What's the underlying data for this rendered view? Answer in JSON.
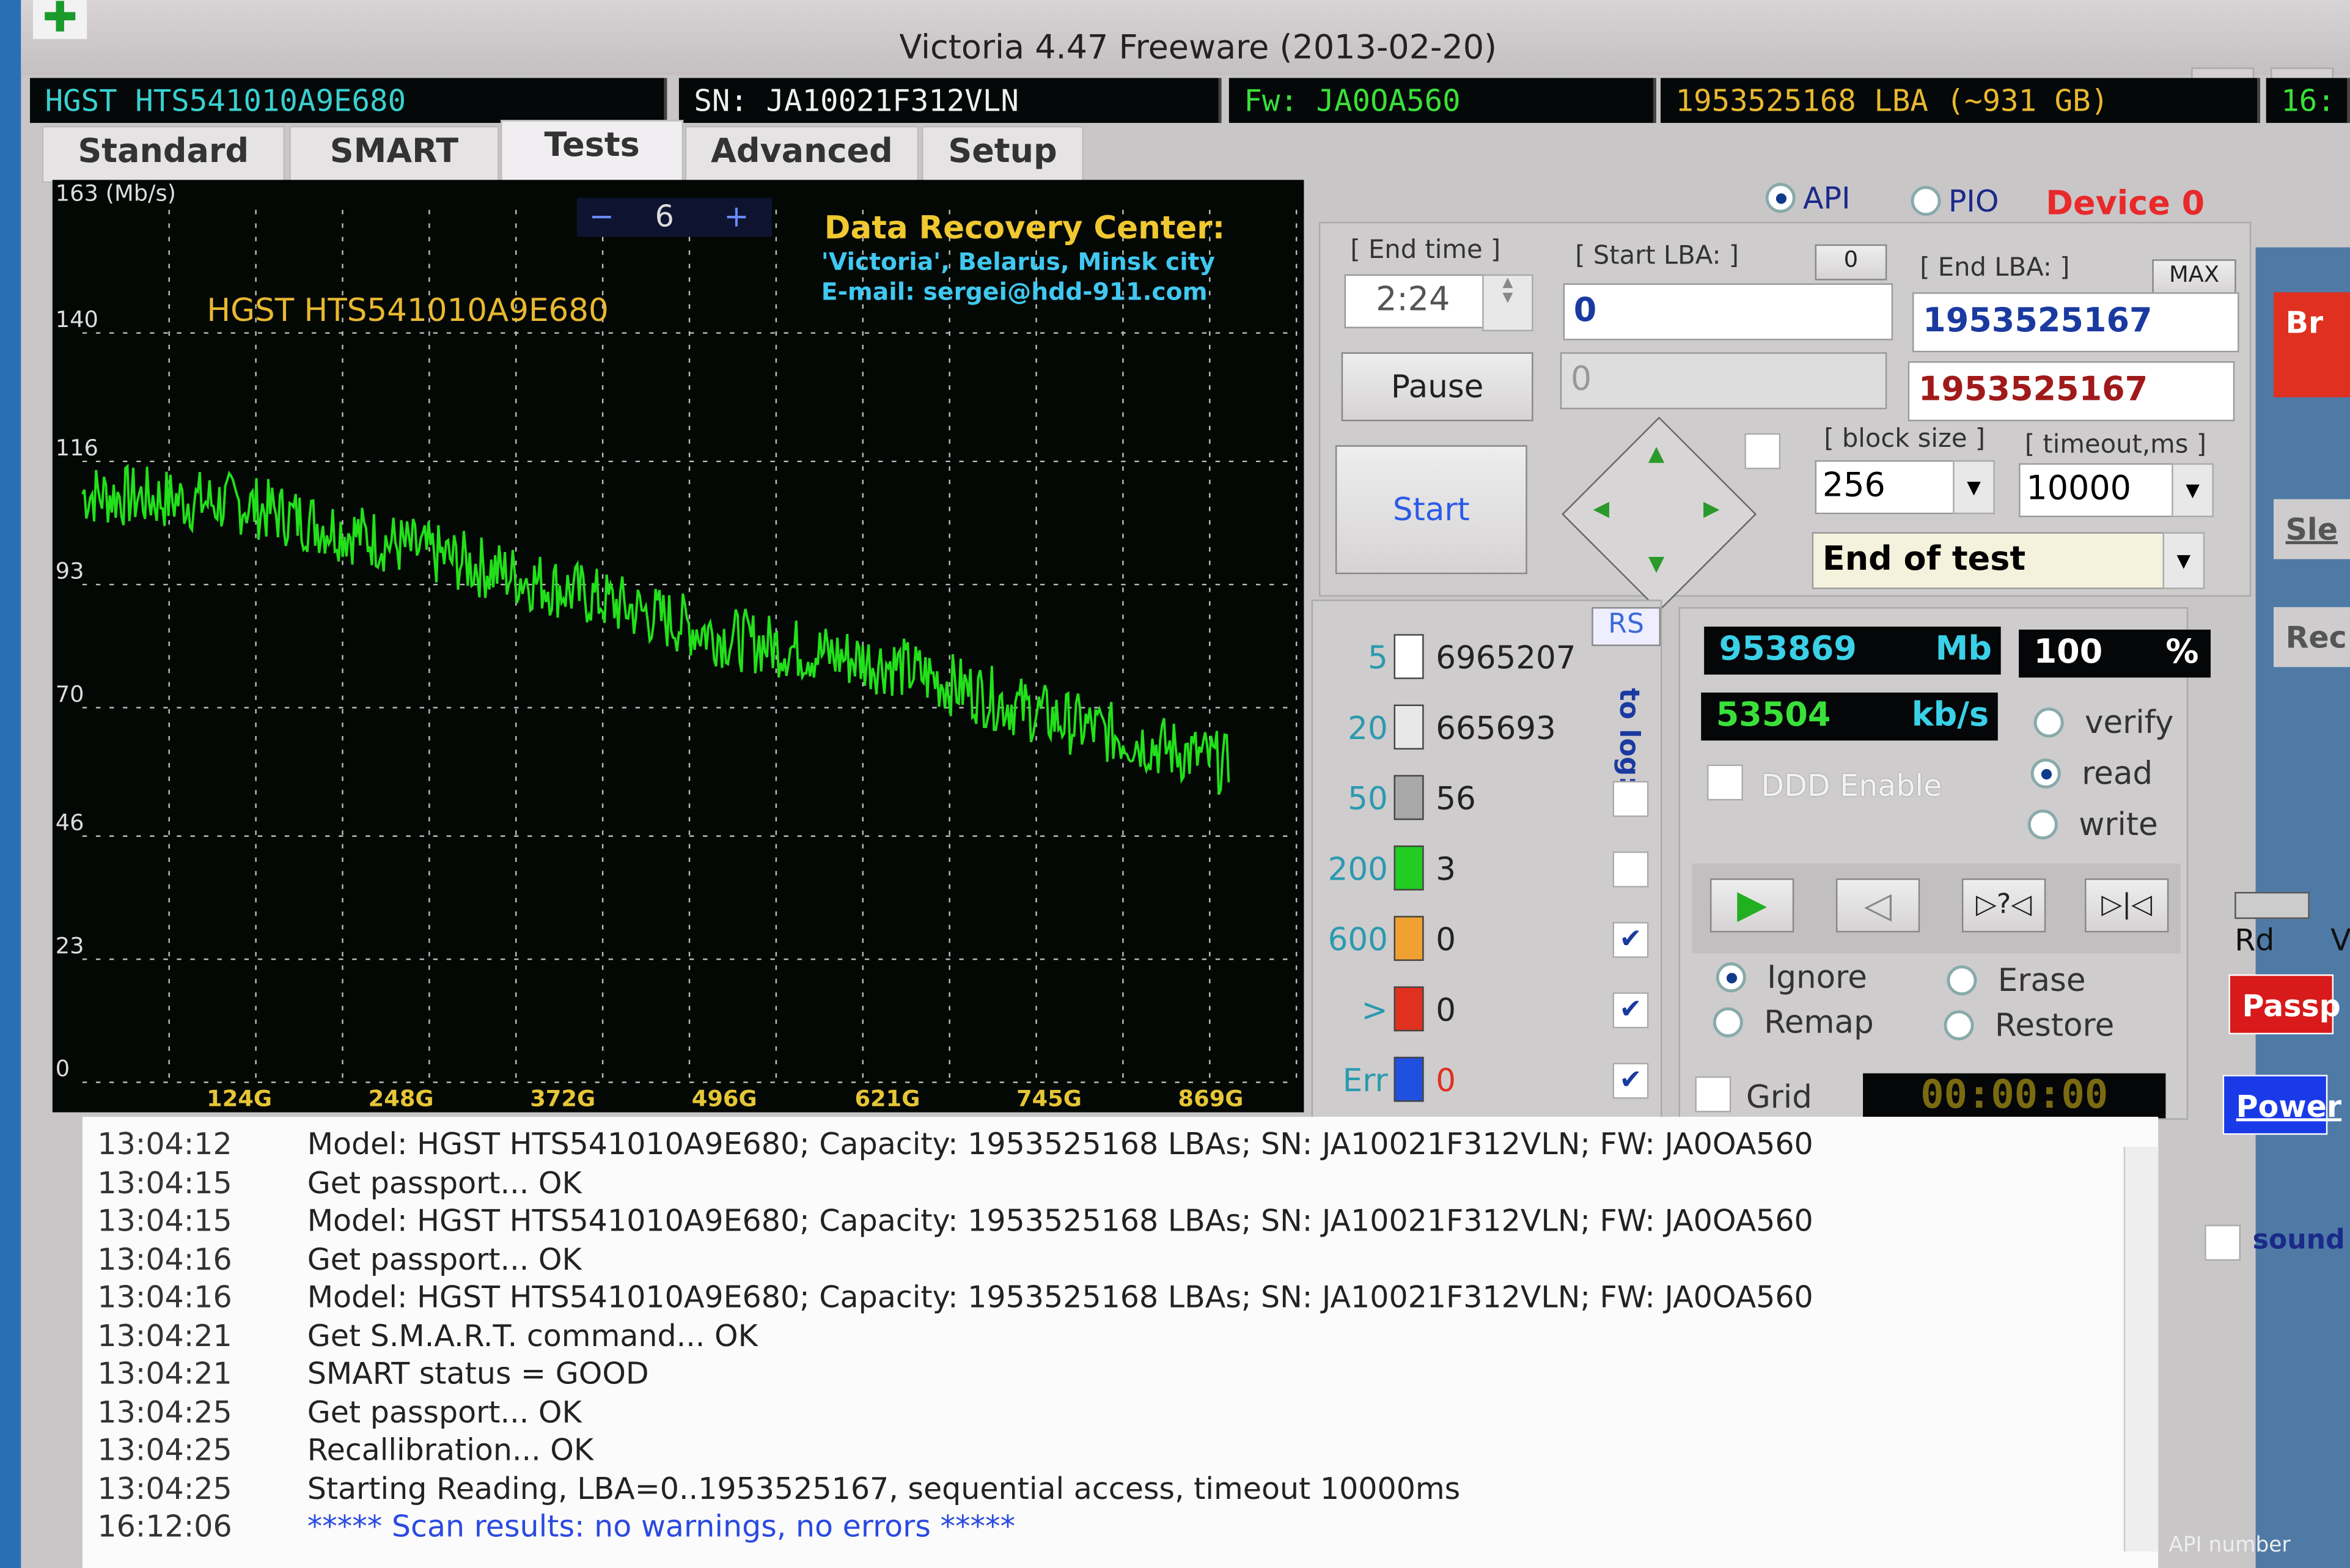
{
  "window": {
    "title": "Victoria 4.47  Freeware (2013-02-20)",
    "minimize": "—",
    "maximize": "☐"
  },
  "info_bar": {
    "model": "HGST HTS541010A9E680",
    "serial": "SN: JA10021F312VLN",
    "firmware": "Fw: JA0OA560",
    "capacity": "1953525168 LBA (~931 GB)",
    "clock": "16:"
  },
  "tabs": [
    {
      "label": "Standard"
    },
    {
      "label": "SMART"
    },
    {
      "label": "Tests",
      "active": true
    },
    {
      "label": "Advanced"
    },
    {
      "label": "Setup"
    }
  ],
  "interface": {
    "api": "API",
    "pio": "PIO",
    "selected": "API",
    "device": "Device 0"
  },
  "graph": {
    "y_unit": "163 (Mb/s)",
    "y_ticks": [
      "140",
      "116",
      "93",
      "70",
      "46",
      "23",
      "0"
    ],
    "x_ticks": [
      "124G",
      "248G",
      "372G",
      "496G",
      "621G",
      "745G",
      "869G"
    ],
    "scale_minus": "−",
    "scale_value": "6",
    "scale_plus": "+",
    "drive_label": "HGST HTS541010A9E680",
    "ad_title": "Data Recovery Center:",
    "ad_line1": "'Victoria', Belarus, Minsk city",
    "ad_line2": "E-mail: sergei@hdd-911.com",
    "line_color": "#22e01a",
    "speed_trend": {
      "x_gb": [
        0,
        124,
        248,
        372,
        496,
        621,
        745,
        869,
        931
      ],
      "mb_s": [
        110,
        108,
        100,
        92,
        83,
        78,
        68,
        60,
        53
      ]
    }
  },
  "controls": {
    "end_time_label": "[ End time ]",
    "end_time": "2:24",
    "start_lba_label": "[ Start LBA: ]",
    "start_lba_btn": "0",
    "start_lba": "0",
    "start_lba_current": "0",
    "end_lba_label": "[ End LBA: ]",
    "end_lba_max": "MAX",
    "end_lba": "1953525167",
    "end_lba_current": "1953525167",
    "pause": "Pause",
    "start": "Start",
    "block_size_label": "[ block size ]",
    "block_size": "256",
    "timeout_label": "[ timeout,ms ]",
    "timeout": "10000",
    "end_action": "End of test"
  },
  "stats": {
    "rs": "RS",
    "to_log": "to log:",
    "rows": [
      {
        "threshold": "5",
        "count": "6965207",
        "color": "#ffffff",
        "log": false,
        "show_check": false
      },
      {
        "threshold": "20",
        "count": "665693",
        "color": "#e8e8e8",
        "log": false,
        "show_check": false
      },
      {
        "threshold": "50",
        "count": "56",
        "color": "#a8a8a8",
        "log": false,
        "show_check": true
      },
      {
        "threshold": "200",
        "count": "3",
        "color": "#22cc22",
        "log": false,
        "show_check": true
      },
      {
        "threshold": "600",
        "count": "0",
        "color": "#f0a030",
        "log": true,
        "show_check": true
      },
      {
        "threshold": ">",
        "count": "0",
        "color": "#e03020",
        "log": true,
        "show_check": true
      },
      {
        "threshold": "Err",
        "count": "0",
        "color": "#2050e0",
        "log": true,
        "show_check": true
      }
    ]
  },
  "progress": {
    "processed": "953869",
    "processed_unit": "Mb",
    "percent": "100",
    "percent_unit": "%",
    "speed": "53504",
    "speed_unit": "kb/s",
    "ddd": "DDD Enable",
    "modes": [
      "verify",
      "read",
      "write"
    ],
    "mode_selected": "read",
    "actions": [
      "Ignore",
      "Erase",
      "Remap",
      "Restore"
    ],
    "action_selected": "Ignore",
    "grid": "Grid",
    "timer": "00:00:00",
    "transport": [
      "play",
      "back",
      "seek-random",
      "seek-end"
    ],
    "transport_labels": {
      "seek_random": "▷?◁",
      "seek_end": "▷|◁"
    }
  },
  "side": {
    "buttons": [
      "Br",
      "Sle",
      "Rec"
    ],
    "rd": "Rd",
    "wr": "V",
    "passp": "Passp",
    "power": "Power",
    "sound": "sound",
    "api_number": "API number"
  },
  "log": [
    {
      "time": "13:04:12",
      "text": "Model: HGST HTS541010A9E680; Capacity: 1953525168 LBAs; SN: JA10021F312VLN; FW: JA0OA560"
    },
    {
      "time": "13:04:15",
      "text": "Get passport... OK"
    },
    {
      "time": "13:04:15",
      "text": "Model: HGST HTS541010A9E680; Capacity: 1953525168 LBAs; SN: JA10021F312VLN; FW: JA0OA560"
    },
    {
      "time": "13:04:16",
      "text": "Get passport... OK"
    },
    {
      "time": "13:04:16",
      "text": "Model: HGST HTS541010A9E680; Capacity: 1953525168 LBAs; SN: JA10021F312VLN; FW: JA0OA560"
    },
    {
      "time": "13:04:21",
      "text": "Get S.M.A.R.T. command... OK"
    },
    {
      "time": "13:04:21",
      "text": "SMART status = GOOD"
    },
    {
      "time": "13:04:25",
      "text": "Get passport... OK"
    },
    {
      "time": "13:04:25",
      "text": "Recallibration... OK"
    },
    {
      "time": "13:04:25",
      "text": "Starting Reading, LBA=0..1953525167, sequential access, timeout 10000ms"
    },
    {
      "time": "16:12:06",
      "text": "***** Scan results: no warnings, no errors *****",
      "highlight": true
    }
  ]
}
